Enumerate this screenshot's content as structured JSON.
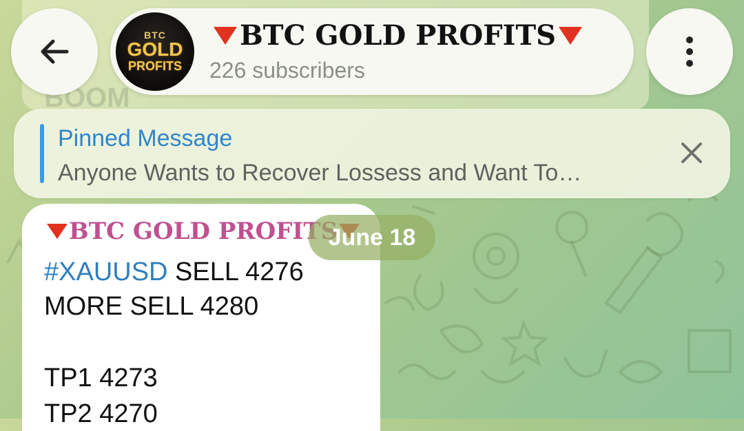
{
  "header": {
    "channel_name": "BTC GOLD PROFITS",
    "subscribers": "226 subscribers",
    "avatar": {
      "line1": "BTC",
      "line2": "GOLD",
      "line3": "PROFITS"
    },
    "back_icon": "arrow-left-icon",
    "menu_icon": "more-vertical-icon"
  },
  "pinned": {
    "title": "Pinned Message",
    "text": "Anyone Wants to Recover Lossess and Want To…",
    "close_icon": "close-icon"
  },
  "date_label": "June 18",
  "message": {
    "sender": "BTC GOLD PROFITS",
    "hashtag": "#XAUUSD",
    "line1_rest": " SELL 4276",
    "line2": "MORE SELL 4280",
    "line3": "TP1 4273",
    "line4": "TP2 4270"
  },
  "background_message": {
    "text": "BOOM"
  },
  "colors": {
    "accent_blue": "#2f86cc",
    "sender_pink": "#c0508f",
    "red_triangle": "#e0321f",
    "gold": "#f0c54f"
  }
}
